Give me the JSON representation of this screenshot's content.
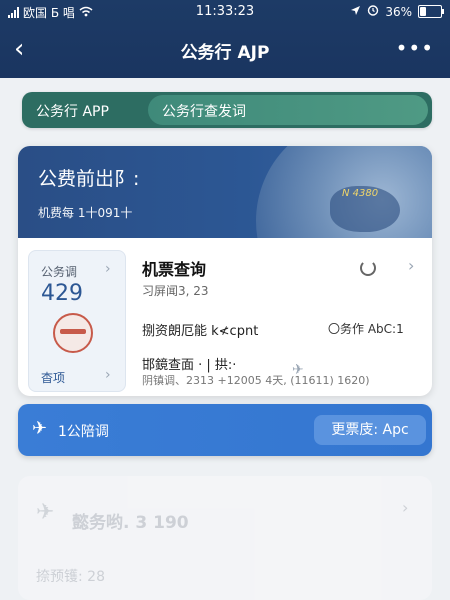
{
  "status_bar": {
    "carrier": "欧国 Б 唱",
    "time": "11:33:23",
    "battery": "36%",
    "battery_level": 0.36,
    "icons": [
      "signal-icon",
      "wifi-icon",
      "location-arrow-icon",
      "alarm-icon",
      "battery-icon"
    ]
  },
  "nav": {
    "back": "‹",
    "title": "公务行 AJP",
    "more": "•••"
  },
  "app_bar": {
    "label": "公务行 APP",
    "segment": "公务行查发词"
  },
  "hero": {
    "title": "公费前岀阝:",
    "subtitle": "机费每 1十091十",
    "code": "N 4380"
  },
  "mini_card": {
    "title": "公务调",
    "count": "429",
    "footer": "杳项"
  },
  "detail": {
    "title": "机票查询",
    "subtitle": "习屏闻3, 23",
    "row1_left": "捌资朗厄能 k≮cpnt",
    "row1_right": "〇务作 AbC:1",
    "row2": "邯鏡查面 · | 拱:·",
    "row3": "阴镇调、2313 +12005     4天, (11611) 1620)"
  },
  "action_bar": {
    "label": "1公陪调",
    "button": "更票庋: Apc"
  },
  "faded_card": {
    "title": "懿务哟. 3 190",
    "subtitle": "捺预镬: 28"
  },
  "colors": {
    "header": "#1d3b66",
    "app_bar": "#2d6d62",
    "hero": "#2c5794",
    "action": "#3a7dd6"
  }
}
